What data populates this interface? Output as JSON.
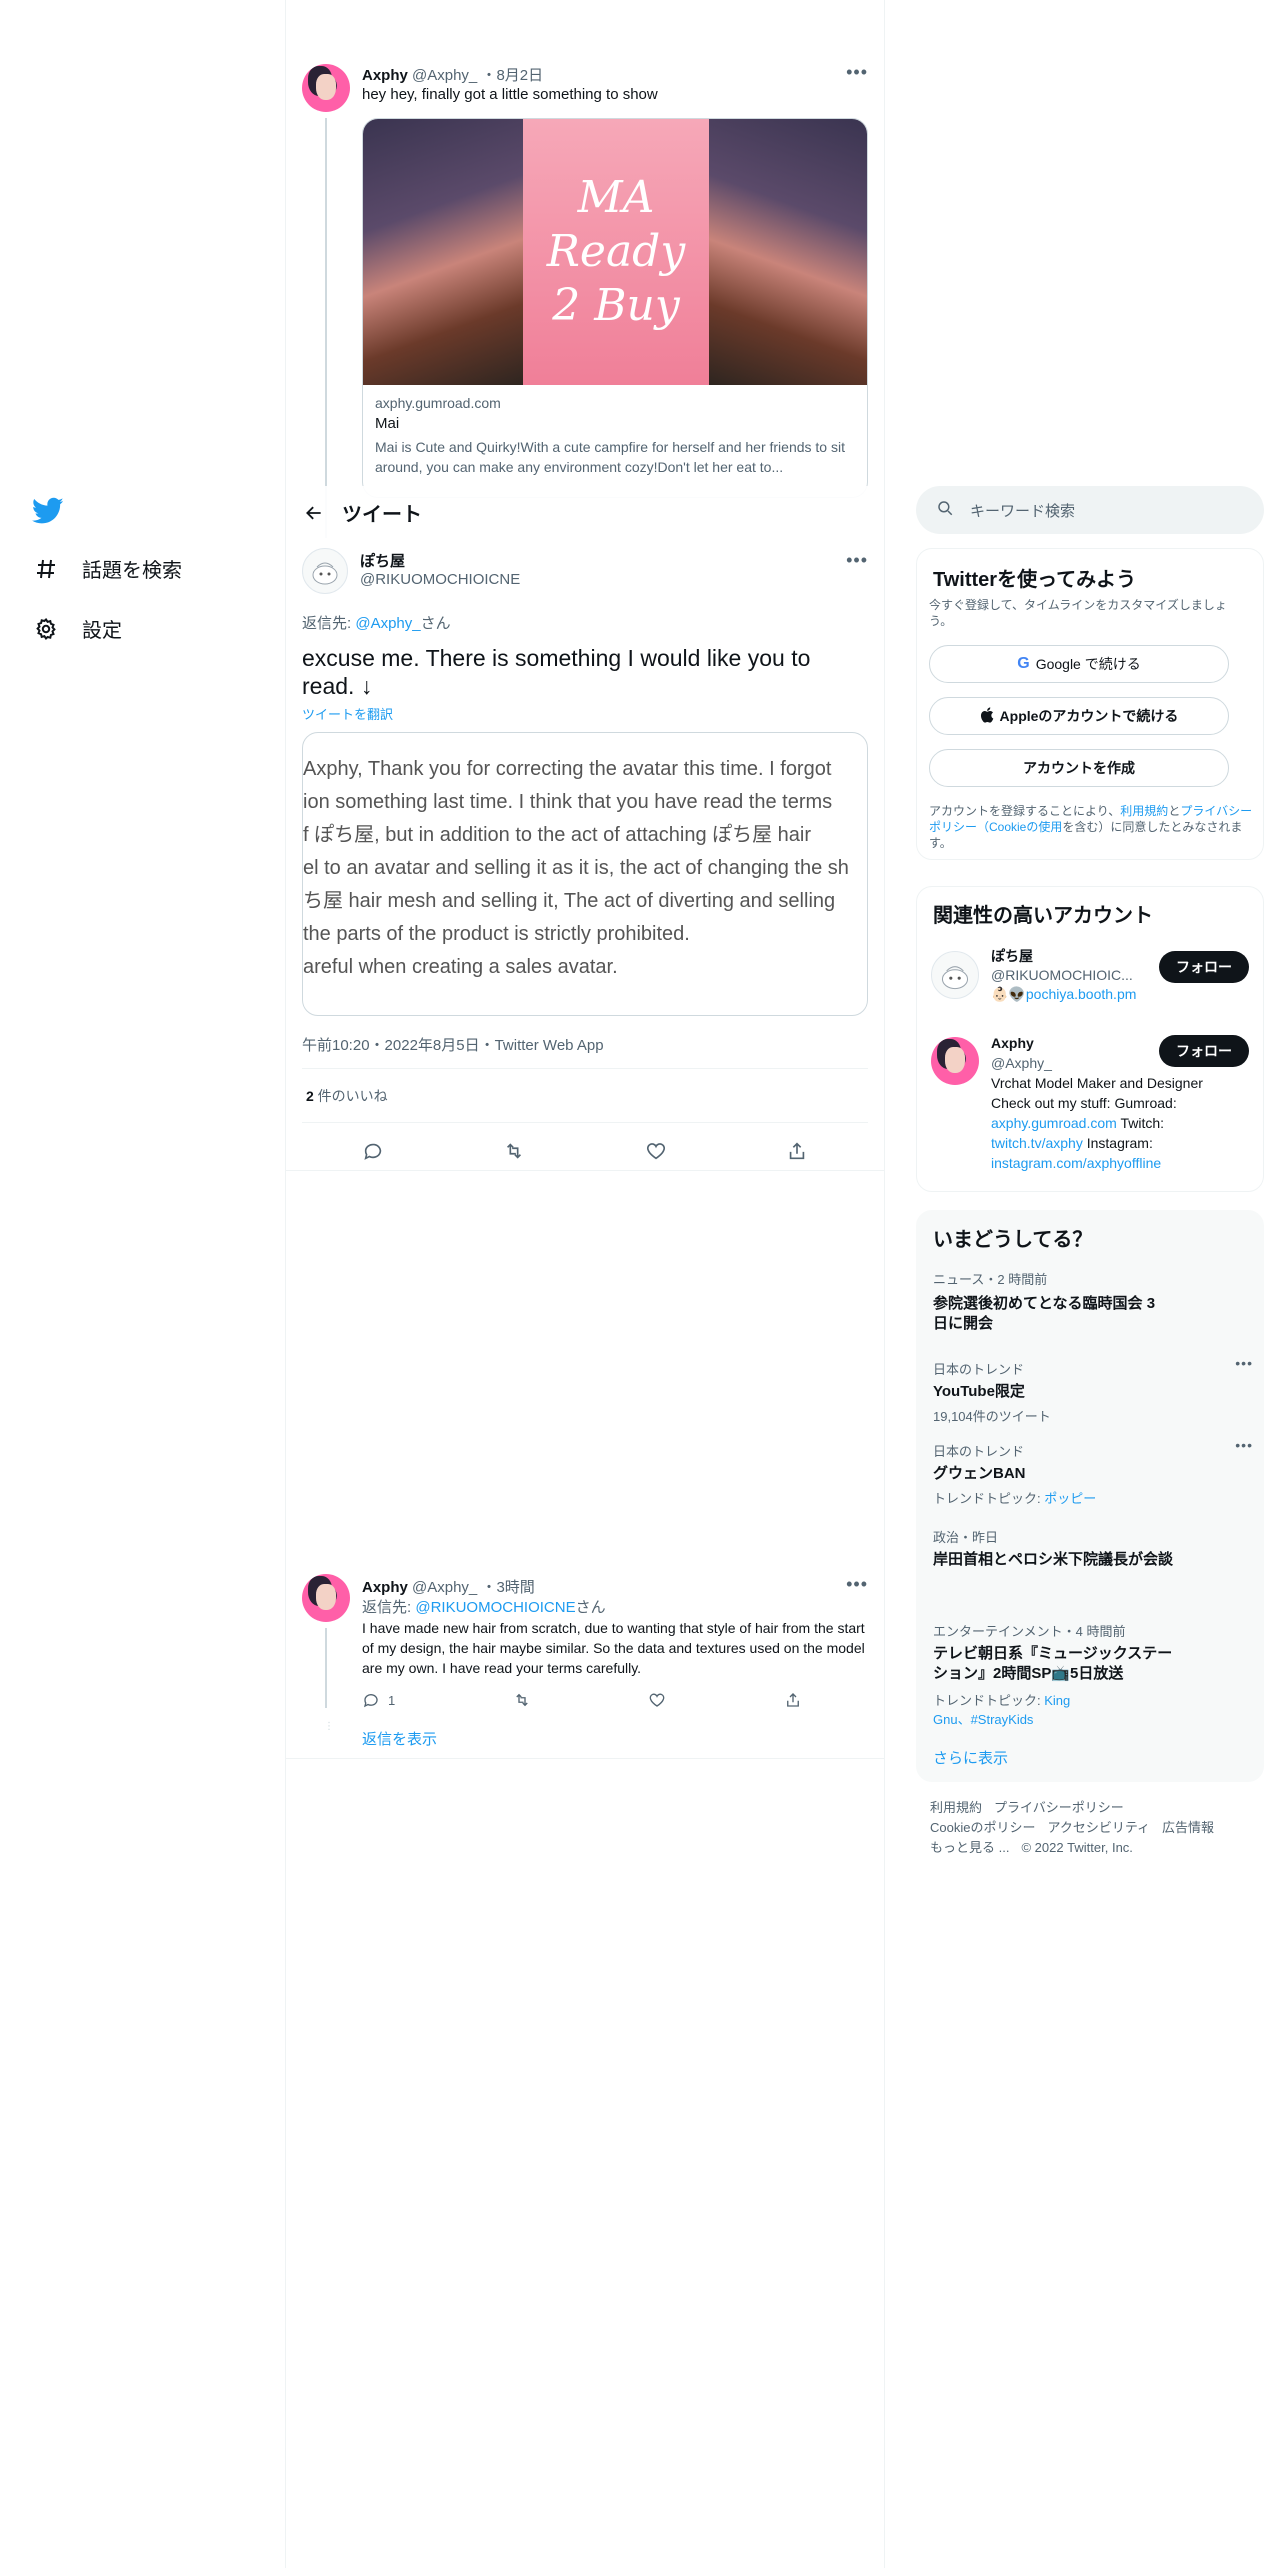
{
  "nav": {
    "logo_icon": "twitter-bird-icon",
    "items": [
      {
        "label": "話題を検索",
        "icon": "hashtag-icon"
      },
      {
        "label": "設定",
        "icon": "gear-icon"
      }
    ]
  },
  "header": {
    "title": "ツイート",
    "back_icon": "arrow-left-icon"
  },
  "parent_tweet": {
    "name": "Axphy",
    "handle": "@Axphy_",
    "date": "・8月2日",
    "text": "hey hey, finally got a little something to show",
    "card": {
      "image_text": "MA Ready 2 Buy",
      "domain": "axphy.gumroad.com",
      "title": "Mai",
      "description": "Mai is Cute and Quirky!With a cute campfire for herself and her friends to sit around, you can make any environment cozy!Don't let her eat to..."
    }
  },
  "main_tweet": {
    "name": "ぽち屋",
    "handle": "@RIKUOMOCHIOICNE",
    "reply_prefix": "返信先: ",
    "reply_handle": "@Axphy_",
    "reply_suffix": "さん",
    "text": "excuse me. There is something I would like you to read. ↓",
    "translate": "ツイートを翻訳",
    "image_lines": [
      " Axphy, Thank you for correcting the avatar this time. I forgot",
      "ion something last time. I think that you have read the terms",
      "f ぽち屋, but in addition to the act of attaching ぽち屋 hair",
      "el to an avatar and selling it as it is, the act of changing the sh",
      "ち屋 hair mesh and selling it, The act of diverting and selling",
      " the parts of the product is strictly prohibited.",
      "areful when creating a sales avatar."
    ],
    "timestamp": "午前10:20・2022年8月5日・Twitter Web App",
    "likes_count": "2",
    "likes_label": " 件のいいね"
  },
  "reply_tweet": {
    "name": "Axphy",
    "handle": "@Axphy_",
    "date": "・3時間",
    "reply_prefix": "返信先: ",
    "reply_handle": "@RIKUOMOCHIOICNE",
    "reply_suffix": "さん",
    "text": "I have made new hair from scratch, due to wanting that style of hair from the start of my design, the hair maybe similar. So the data and textures used on the model are my own. I have read your terms carefully.",
    "reply_count": "1",
    "show_replies": "返信を表示"
  },
  "search": {
    "placeholder": "キーワード検索"
  },
  "signup": {
    "title": "Twitterを使ってみよう",
    "subtitle": "今すぐ登録して、タイムラインをカスタマイズしましょう。",
    "google": "Google で続ける",
    "apple": "Appleのアカウントで続ける",
    "create": "アカウントを作成",
    "legal_1": "アカウントを登録することにより、",
    "legal_link1": "利用規約",
    "legal_2": "と",
    "legal_link2": "プライバシーポリシー（Cookieの使用",
    "legal_3": "を含む）に同意したとみなされます。"
  },
  "related": {
    "title": "関連性の高いアカウント",
    "accounts": [
      {
        "name": "ぽち屋",
        "handle": "@RIKUOMOCHIOIC...",
        "follow": "フォロー",
        "bio_emoji": "👶🏻👽",
        "bio_link": "pochiya.booth.pm"
      },
      {
        "name": "Axphy",
        "handle": "@Axphy_",
        "follow": "フォロー",
        "bio_1": "Vrchat Model Maker and Designer Check out my stuff: Gumroad: ",
        "bio_link1": "axphy.gumroad.com",
        "bio_2": " Twitch: ",
        "bio_link2": "twitch.tv/axphy",
        "bio_3": " Instagram: ",
        "bio_link3": "instagram.com/axphyoffline"
      }
    ]
  },
  "trends": {
    "title": "いまどうしてる？",
    "items": [
      {
        "category": "ニュース・2 時間前",
        "title": "参院選後初めてとなる臨時国会 3 日に開会",
        "meta": ""
      },
      {
        "category": "日本のトレンド",
        "title": "YouTube限定",
        "meta": "19,104件のツイート"
      },
      {
        "category": "日本のトレンド",
        "title": "グウェンBAN",
        "meta": "トレンドトピック: ",
        "meta_link": "ポッピー"
      },
      {
        "category": "政治・昨日",
        "title": "岸田首相とペロシ米下院議長が会談",
        "meta": ""
      },
      {
        "category": "エンターテインメント・4 時間前",
        "title": "テレビ朝日系『ミュージックステーション』2時間SP📺5日放送",
        "meta": "トレンドトピック: ",
        "meta_link": "King Gnu、#StrayKids"
      }
    ],
    "show_more": "さらに表示"
  },
  "footer": {
    "line1": [
      "利用規約",
      "プライバシーポリシー"
    ],
    "line2": [
      "Cookieのポリシー",
      "アクセシビリティ",
      "広告情報"
    ],
    "line3": [
      "もっと見る ...",
      "© 2022 Twitter, Inc."
    ]
  },
  "colors": {
    "accent": "#1d9bf0",
    "text": "#0f1419",
    "muted": "#536471",
    "border": "#eff3f4"
  }
}
